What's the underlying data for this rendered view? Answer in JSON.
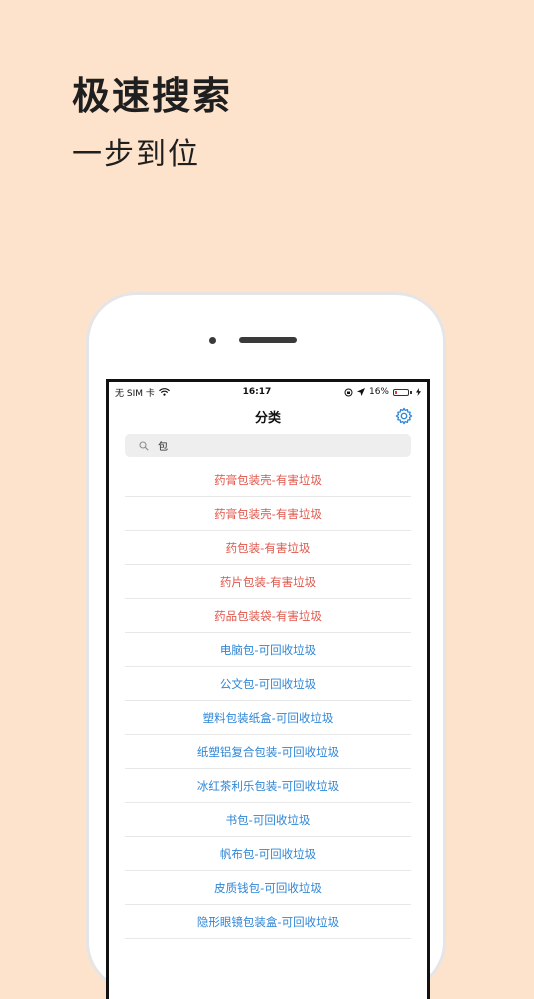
{
  "hero": {
    "title": "极速搜索",
    "subtitle": "一步到位"
  },
  "statusbar": {
    "carrier": "无 SIM 卡",
    "time": "16:17",
    "battery": "16%",
    "battery_level": 0.16,
    "battery_color": "#e53935"
  },
  "navbar": {
    "title": "分类",
    "settings_icon": "gear-icon"
  },
  "search": {
    "value": "包"
  },
  "colors": {
    "hazard": "#e0574c",
    "recyclable": "#2f86d6",
    "background": "#fde3cb"
  },
  "results": [
    {
      "label": "药膏包装壳-有害垃圾",
      "type": "hazard"
    },
    {
      "label": "药膏包装壳-有害垃圾",
      "type": "hazard"
    },
    {
      "label": "药包装-有害垃圾",
      "type": "hazard"
    },
    {
      "label": "药片包装-有害垃圾",
      "type": "hazard"
    },
    {
      "label": "药品包装袋-有害垃圾",
      "type": "hazard"
    },
    {
      "label": "电脑包-可回收垃圾",
      "type": "recycle"
    },
    {
      "label": "公文包-可回收垃圾",
      "type": "recycle"
    },
    {
      "label": "塑料包装纸盒-可回收垃圾",
      "type": "recycle"
    },
    {
      "label": "纸塑铝复合包装-可回收垃圾",
      "type": "recycle"
    },
    {
      "label": "冰红茶利乐包装-可回收垃圾",
      "type": "recycle"
    },
    {
      "label": "书包-可回收垃圾",
      "type": "recycle"
    },
    {
      "label": "帆布包-可回收垃圾",
      "type": "recycle"
    },
    {
      "label": "皮质钱包-可回收垃圾",
      "type": "recycle"
    },
    {
      "label": "隐形眼镜包装盒-可回收垃圾",
      "type": "recycle"
    }
  ]
}
